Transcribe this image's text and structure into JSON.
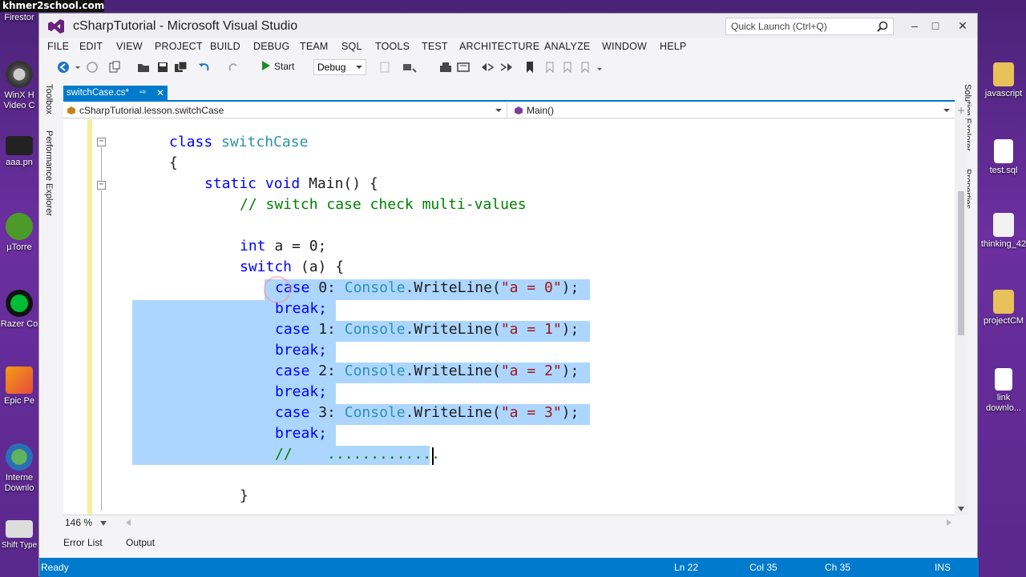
{
  "watermark": "khmer2school.com",
  "desktop": {
    "left_icons": [
      {
        "label": "Firestor"
      },
      {
        "label": "WinX H\nVideo C"
      },
      {
        "label": "aaa.pn"
      },
      {
        "label": "µTorre"
      },
      {
        "label": "Razer Co"
      },
      {
        "label": "Epic Pe"
      },
      {
        "label": "Interne\nDownlo"
      },
      {
        "label": "Shift Type"
      }
    ],
    "right_icons": [
      {
        "label": "javascript"
      },
      {
        "label": "test.sql"
      },
      {
        "label": "thinking_42"
      },
      {
        "label": "projectCM"
      },
      {
        "label": "link\ndownlo..."
      }
    ]
  },
  "window": {
    "title": "cSharpTutorial - Microsoft Visual Studio",
    "quick_launch_placeholder": "Quick Launch (Ctrl+Q)",
    "minimize": "‒",
    "maximize": "□",
    "close": "✕"
  },
  "menu": [
    "FILE",
    "EDIT",
    "VIEW",
    "PROJECT",
    "BUILD",
    "DEBUG",
    "TEAM",
    "SQL",
    "TOOLS",
    "TEST",
    "ARCHITECTURE",
    "ANALYZE",
    "WINDOW",
    "HELP"
  ],
  "toolbar": {
    "start_label": "Start",
    "configuration": "Debug"
  },
  "left_tools": {
    "toolbox": "Toolbox",
    "performance": "Performance Explorer"
  },
  "right_tools": {
    "solution": "Solution Explorer",
    "properties": "Properties"
  },
  "document_tab": {
    "label": "switchCase.cs*",
    "pin": "⬤",
    "close": "✕"
  },
  "navbar": {
    "type_scope": "cSharpTutorial.lesson.switchCase",
    "member_scope": "Main()"
  },
  "code": {
    "l1_kw": "class",
    "l1_ty": "switchCase",
    "l2": "{",
    "l3_kw1": "static",
    "l3_kw2": "void",
    "l3_rest": "Main() {",
    "l4": "// switch case check multi-values",
    "l6_kw": "int",
    "l6_rest": "a = 0;",
    "l7_kw": "switch",
    "l7_rest": "(a) {",
    "case_kw": "case",
    "break_kw": "break;",
    "console": "Console",
    "writeline": ".WriteLine(",
    "cases": [
      {
        "num": "0",
        "str": "\"a = 0\""
      },
      {
        "num": "1",
        "str": "\"a = 1\""
      },
      {
        "num": "2",
        "str": "\"a = 2\""
      },
      {
        "num": "3",
        "str": "\"a = 3\""
      }
    ],
    "end_paren": ");",
    "l15_comment": "//    .............",
    "l17": "}"
  },
  "zoom": "146 %",
  "bottom_tabs": {
    "errors": "Error List",
    "output": "Output"
  },
  "status": {
    "ready": "Ready",
    "ln": "Ln 22",
    "col": "Col 35",
    "ch": "Ch 35",
    "mode": "INS"
  },
  "colors": {
    "accent": "#007acc",
    "keyword": "#0000ff",
    "type": "#2b91af",
    "comment": "#008000",
    "string": "#a31515",
    "selection": "#add6ff"
  }
}
